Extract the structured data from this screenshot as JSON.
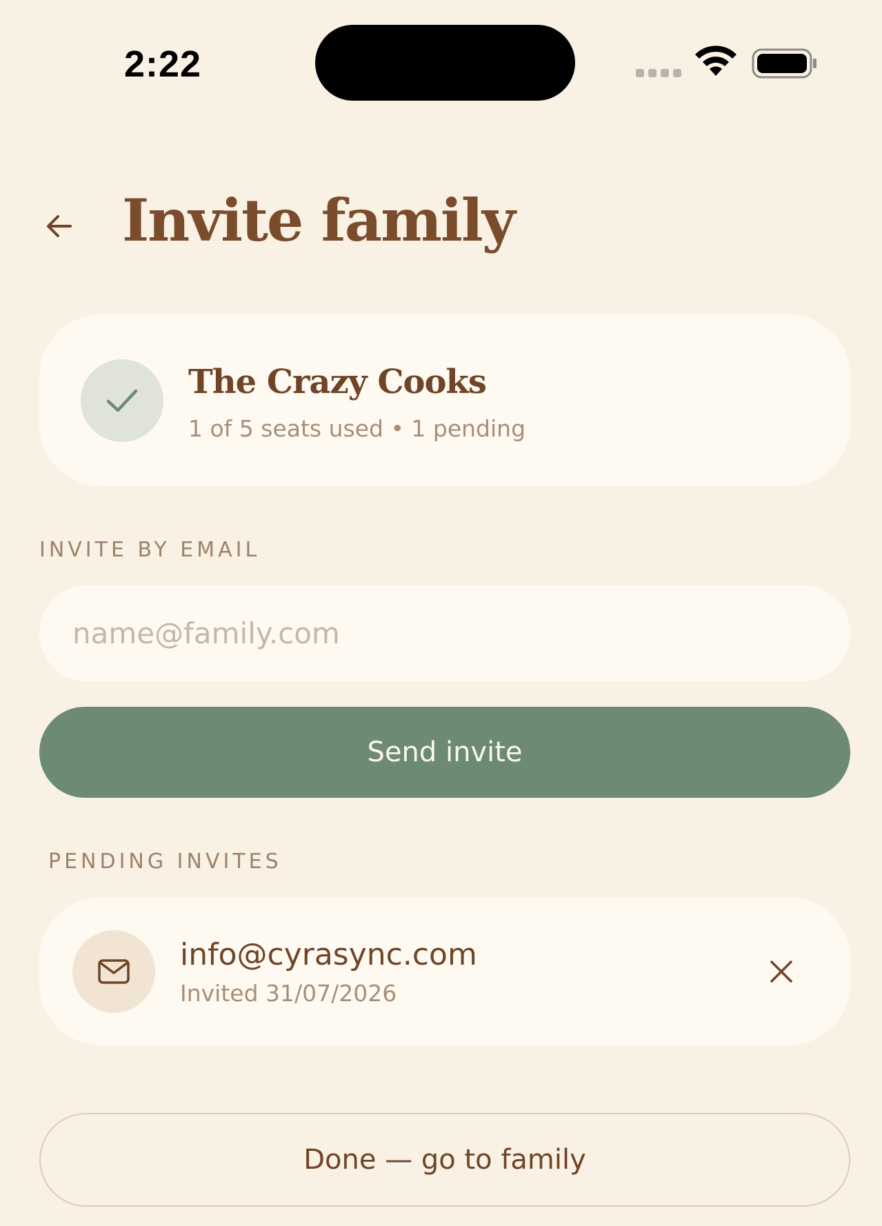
{
  "status_bar": {
    "time": "2:22"
  },
  "header": {
    "title": "Invite family"
  },
  "family": {
    "name": "The Crazy Cooks",
    "meta": "1 of 5 seats used • 1 pending"
  },
  "invite": {
    "section_label": "INVITE BY EMAIL",
    "email_placeholder": "name@family.com",
    "email_value": "",
    "send_label": "Send invite"
  },
  "pending": {
    "section_label": "PENDING INVITES",
    "items": [
      {
        "email": "info@cyrasync.com",
        "invited": "Invited 31/07/2026"
      }
    ]
  },
  "footer": {
    "done_label": "Done — go to family"
  },
  "colors": {
    "background": "#F9F1E3",
    "card": "#FEFAF1",
    "accent_green": "#6C8A74",
    "brown": "#7A4C2C"
  },
  "icons": [
    "back-arrow-icon",
    "check-icon",
    "mail-icon",
    "close-icon",
    "wifi-icon",
    "battery-icon"
  ]
}
